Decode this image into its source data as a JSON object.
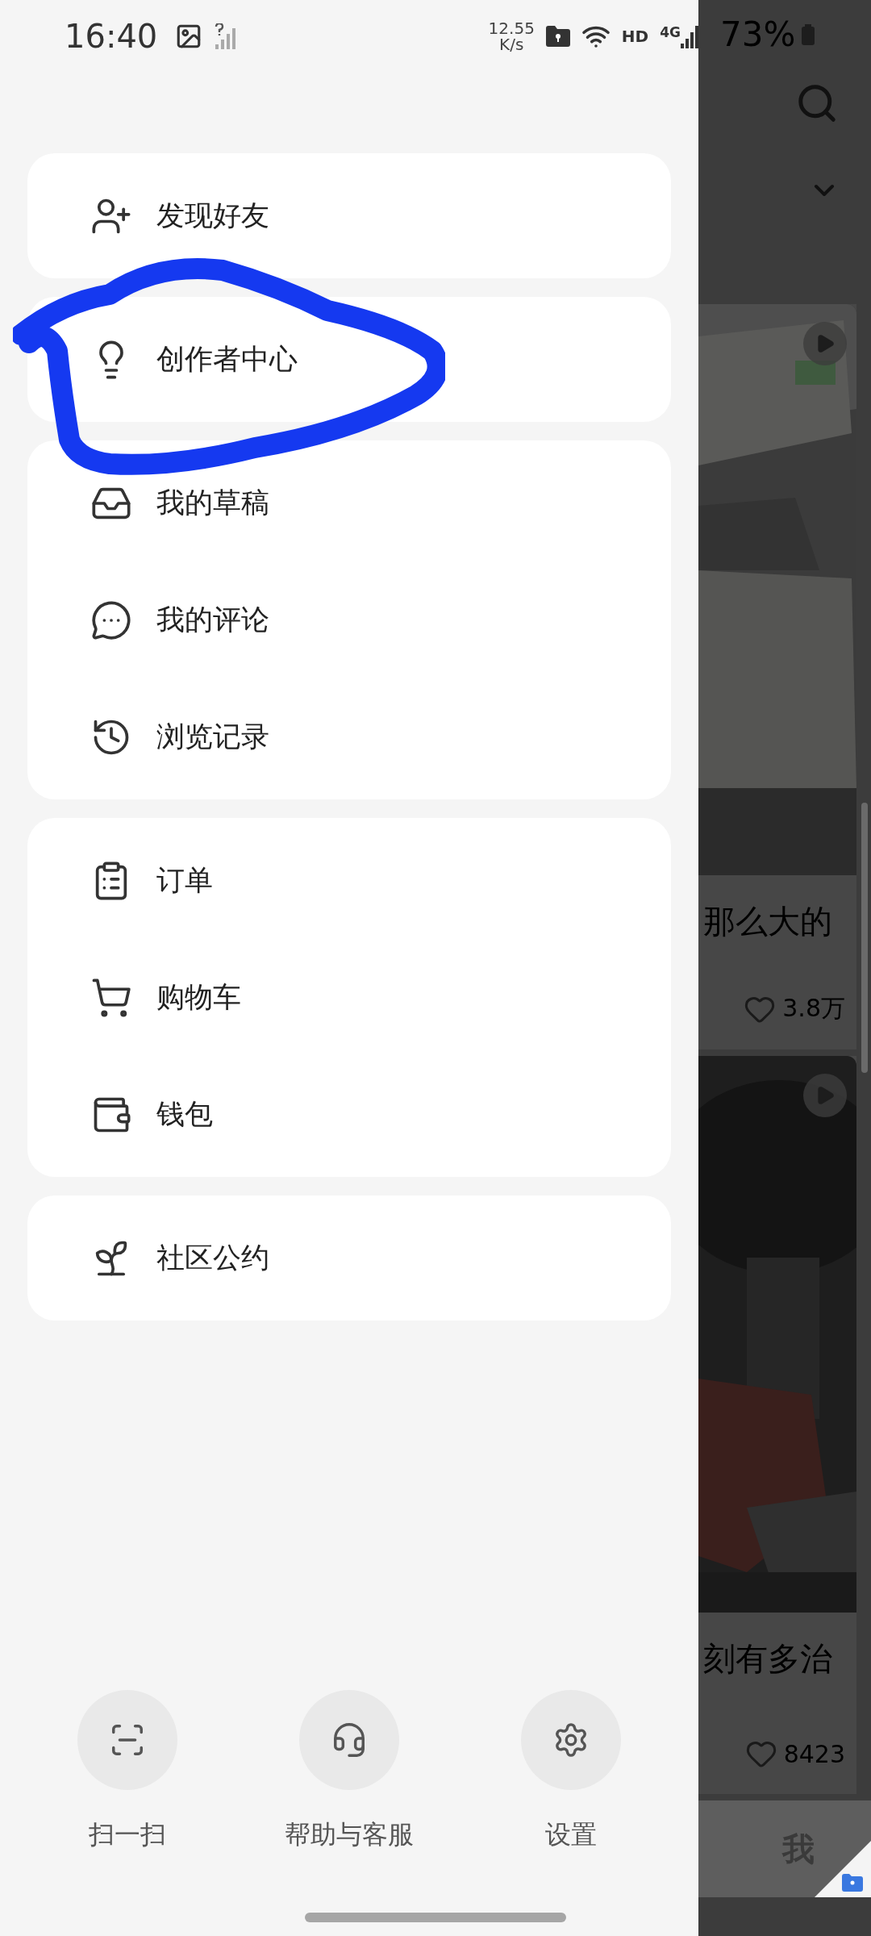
{
  "status_bar": {
    "time": "16:40",
    "speed_value": "12.55",
    "speed_unit": "K/s",
    "hd": "HD",
    "network_type": "4G",
    "battery": "73%"
  },
  "menu_groups": [
    {
      "items": [
        {
          "kind": "add-friend",
          "label": "发现好友"
        }
      ]
    },
    {
      "items": [
        {
          "kind": "creator",
          "label": "创作者中心"
        }
      ]
    },
    {
      "items": [
        {
          "kind": "drafts",
          "label": "我的草稿"
        },
        {
          "kind": "comments",
          "label": "我的评论"
        },
        {
          "kind": "history",
          "label": "浏览记录"
        }
      ]
    },
    {
      "items": [
        {
          "kind": "orders",
          "label": "订单"
        },
        {
          "kind": "cart",
          "label": "购物车"
        },
        {
          "kind": "wallet",
          "label": "钱包"
        }
      ]
    },
    {
      "items": [
        {
          "kind": "community",
          "label": "社区公约"
        }
      ]
    }
  ],
  "bottom_actions": [
    {
      "kind": "scan",
      "label": "扫一扫"
    },
    {
      "kind": "help",
      "label": "帮助与客服"
    },
    {
      "kind": "settings",
      "label": "设置"
    }
  ],
  "annotation": {
    "kind": "scribble"
  },
  "feed": {
    "posts": [
      {
        "title": "那么大的",
        "likes": "3.8万"
      },
      {
        "title": "刻有多治",
        "likes": "8423"
      }
    ],
    "tab": "我"
  }
}
